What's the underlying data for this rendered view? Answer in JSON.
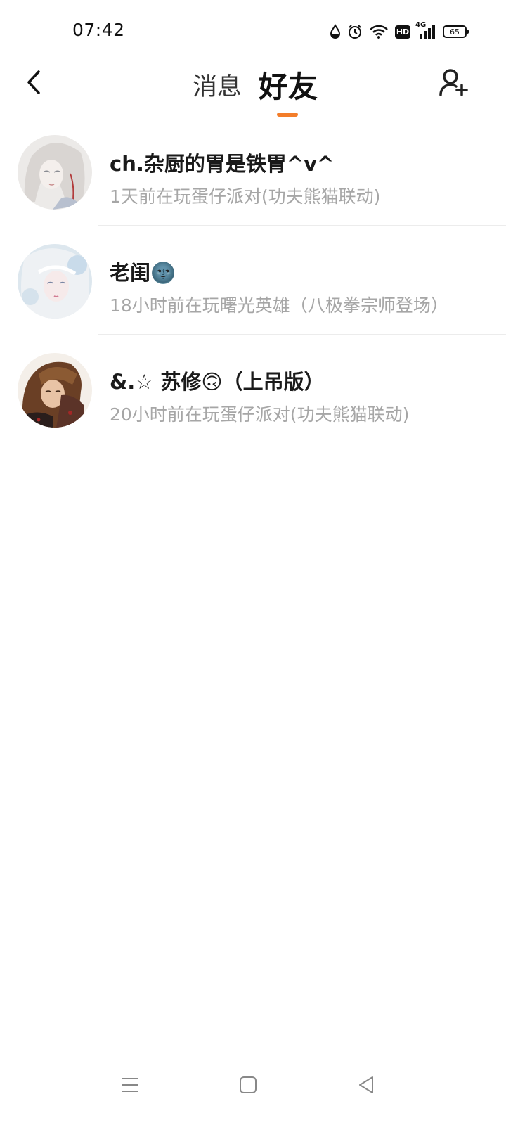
{
  "status_bar": {
    "time": "07:42",
    "icons": [
      "water-drop-icon",
      "alarm-icon",
      "wifi-icon",
      "hd-icon",
      "signal-4g-icon",
      "battery-icon"
    ],
    "hd_label": "HD",
    "network_label": "4G",
    "battery_level": "65"
  },
  "header": {
    "back_icon": "chevron-left-icon",
    "tabs": [
      {
        "label": "消息",
        "active": false
      },
      {
        "label": "好友",
        "active": true
      }
    ],
    "accent_color": "#f37d2a",
    "add_friend_icon": "add-user-icon"
  },
  "friends": [
    {
      "name": "ch.杂厨的胃是铁胃^v^",
      "status": "1天前在玩蛋仔派对(功夫熊猫联动)"
    },
    {
      "name": "老闺🌚",
      "status": "18小时前在玩曙光英雄（八极拳宗师登场）"
    },
    {
      "name": "&.☆ 苏修🙃（上吊版）",
      "status": "20小时前在玩蛋仔派对(功夫熊猫联动)"
    }
  ],
  "system_nav": {
    "icons": [
      "menu-icon",
      "home-icon",
      "back-triangle-icon"
    ]
  }
}
